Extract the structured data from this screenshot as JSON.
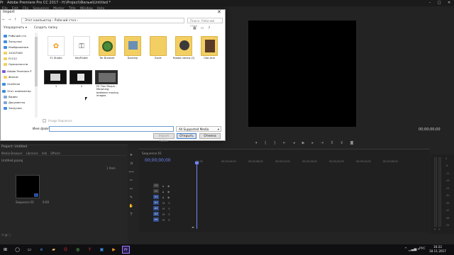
{
  "app": {
    "title": "Adobe Premiere Pro CC 2017 - H:\\Project\\Фильм\\Untitled *",
    "logo": "Pr",
    "window_controls": [
      "–",
      "□",
      "✕"
    ]
  },
  "menu": [
    "File",
    "Edit",
    "Clip",
    "Sequence",
    "Marker",
    "Title",
    "Window",
    "Help"
  ],
  "project_panel": {
    "title": "Project: Untitled",
    "tabs": [
      "Media Browser",
      "Libraries",
      "Info",
      "Effects"
    ],
    "file_name": "Untitled.prproj",
    "item_count": "1 Item",
    "sequence_name": "Sequence 01",
    "sequence_duration": "0:00"
  },
  "timeline": {
    "title": "Sequence 01",
    "timecode": "00;00;00;00",
    "ruler_labels": [
      "00;00",
      "00;00;04;00",
      "00;00;08;00",
      "00;00;12;00",
      "00;00;16;00",
      "00;00;20;00",
      "00;00;24;00",
      "00;00;28;00"
    ],
    "tracks": [
      "V3",
      "V2",
      "V1",
      "A1",
      "A2",
      "A3",
      "A4"
    ]
  },
  "program_monitor": {
    "timecode": "00;00;00;00"
  },
  "audio_meter": {
    "scale": [
      "0",
      "-6",
      "-12",
      "-18",
      "-24",
      "-30",
      "-36",
      "-42",
      "-48",
      "-54"
    ],
    "channels": [
      "S",
      "S"
    ]
  },
  "dialog": {
    "title": "Import",
    "address": "Этот компьютер › Рабочий стол ›",
    "search_placeholder": "Поиск: Рабочий стол",
    "toolbar": {
      "organize": "Упорядочить ▾",
      "new_folder": "Создать папку"
    },
    "nav_items": [
      {
        "label": "Рабочий сто",
        "icon": "desktop-icon",
        "color": "#3d8ee0"
      },
      {
        "label": "Загрузки",
        "icon": "downloads-icon",
        "color": "#3d8ee0"
      },
      {
        "label": "Изображения",
        "icon": "pictures-icon",
        "color": "#3d8ee0"
      },
      {
        "label": "10107000",
        "icon": "folder-icon",
        "color": "#f3cf63"
      },
      {
        "label": "FL512",
        "icon": "folder-icon",
        "color": "#f3cf63"
      },
      {
        "label": "Одноклассни",
        "icon": "folder-icon",
        "color": "#f3cf63"
      },
      {
        "label": "Adobe Premiere P",
        "icon": "premiere-icon",
        "color": "#7c5cd8"
      },
      {
        "label": "Фильм",
        "icon": "folder-icon",
        "color": "#f3cf63"
      },
      {
        "label": "OneDrive",
        "icon": "onedrive-icon",
        "color": "#3d8ee0"
      },
      {
        "label": "Этот компьютер",
        "icon": "computer-icon",
        "color": "#3d8ee0"
      },
      {
        "label": "Видео",
        "icon": "videos-icon",
        "color": "#7ea8d8"
      },
      {
        "label": "Документы",
        "icon": "documents-icon",
        "color": "#7ea8d8"
      },
      {
        "label": "Загрузки",
        "icon": "downloads-icon",
        "color": "#3d8ee0"
      }
    ],
    "files": [
      {
        "label": "FL Studio",
        "kind": "app"
      },
      {
        "label": "KeyFinder",
        "kind": "app"
      },
      {
        "label": "Tor Browser",
        "kind": "app"
      },
      {
        "label": "Баннер",
        "kind": "folder"
      },
      {
        "label": "Боле",
        "kind": "folder"
      },
      {
        "label": "Новая папка (2)",
        "kind": "folder"
      },
      {
        "label": "Све-Ана",
        "kind": "folder"
      },
      {
        "label": "1",
        "kind": "video"
      },
      {
        "label": "2",
        "kind": "video"
      },
      {
        "label": "FE Flex Morph - Morphing between moving images",
        "kind": "video"
      }
    ],
    "image_sequence_label": "Image Sequence",
    "file_name_label": "Имя файла:",
    "file_name_value": "",
    "filter_value": "All Supported Media",
    "import_folder_label": "Import Folder",
    "open_label": "Открыть",
    "cancel_label": "Отмена"
  },
  "taskbar": {
    "apps": [
      "windows-start-icon",
      "search-icon",
      "task-view-icon",
      "edge-icon",
      "explorer-icon",
      "opera-icon",
      "chrome-icon",
      "yandex-icon",
      "store-icon",
      "media-icon",
      "premiere-icon"
    ],
    "language": "РУС",
    "time": "16:22",
    "date": "18.11.2017"
  }
}
